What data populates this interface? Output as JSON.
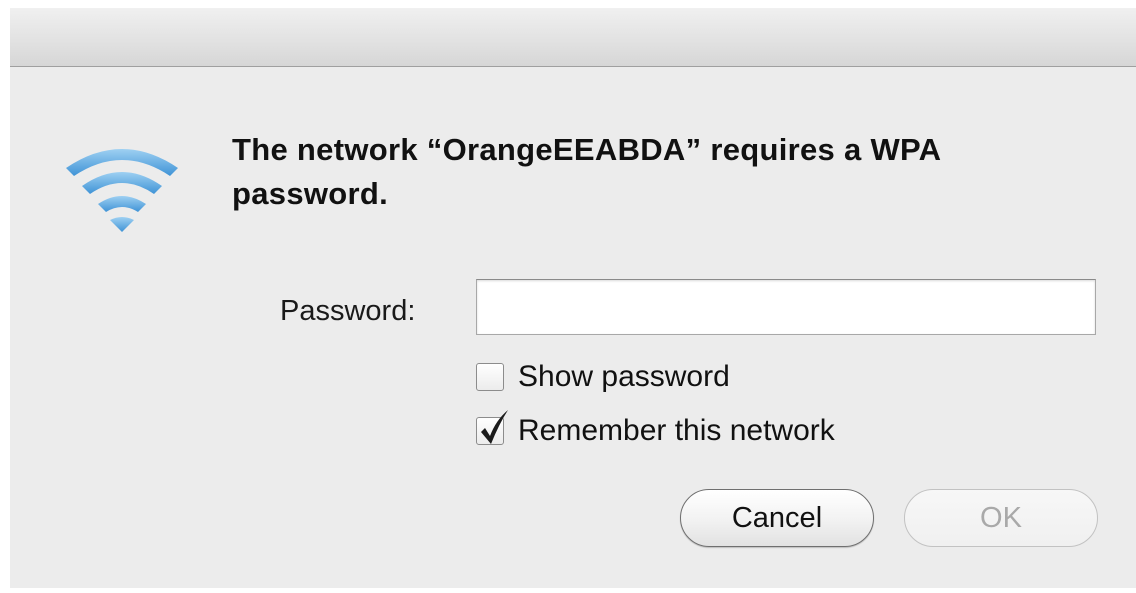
{
  "dialog": {
    "message": "The network “OrangeEEABDA” requires a WPA password.",
    "icon": "wifi-icon",
    "accent_color": "#5aa7de"
  },
  "form": {
    "password_label": "Password:",
    "password_value": "",
    "show_password": {
      "label": "Show password",
      "checked": false
    },
    "remember_network": {
      "label": "Remember this network",
      "checked": true
    }
  },
  "buttons": {
    "cancel_label": "Cancel",
    "ok_label": "OK",
    "ok_enabled": false
  }
}
